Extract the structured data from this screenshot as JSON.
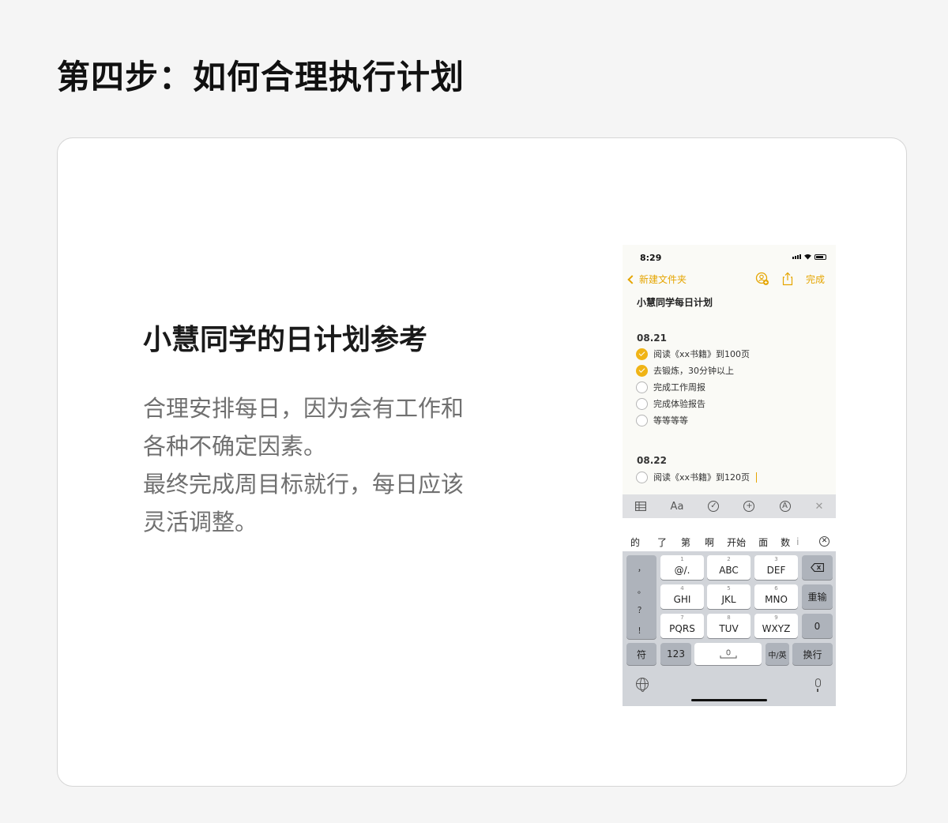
{
  "page": {
    "title": "第四步：如何合理执行计划"
  },
  "card": {
    "title": "小慧同学的日计划参考",
    "body_lines": [
      "合理安排每日，因为会有工作和",
      "各种不确定因素。",
      "最终完成周目标就行，每日应该",
      "灵活调整。"
    ]
  },
  "phone": {
    "status": {
      "time": "8:29"
    },
    "nav": {
      "back_label": "新建文件夹",
      "done_label": "完成"
    },
    "note": {
      "title": "小慧同学每日计划",
      "sections": [
        {
          "date": "08.21",
          "items": [
            {
              "text": "阅读《xx书籍》到100页",
              "done": true
            },
            {
              "text": "去锻炼，30分钟以上",
              "done": true
            },
            {
              "text": "完成工作周报",
              "done": false
            },
            {
              "text": "完成体验报告",
              "done": false
            },
            {
              "text": "等等等等",
              "done": false
            }
          ]
        },
        {
          "date": "08.22",
          "items": [
            {
              "text": "阅读《xx书籍》到120页",
              "done": false
            }
          ]
        }
      ]
    },
    "toolbar": {
      "format_label": "Aa"
    },
    "candidates": [
      "的",
      "了",
      "第",
      "啊",
      "开始",
      "面",
      "数",
      "i"
    ],
    "keyboard": {
      "punct": [
        "，",
        "。",
        "？",
        "！"
      ],
      "rows": [
        [
          {
            "num": "1",
            "label": "@/."
          },
          {
            "num": "2",
            "label": "ABC"
          },
          {
            "num": "3",
            "label": "DEF"
          }
        ],
        [
          {
            "num": "4",
            "label": "GHI"
          },
          {
            "num": "5",
            "label": "JKL"
          },
          {
            "num": "6",
            "label": "MNO"
          }
        ],
        [
          {
            "num": "7",
            "label": "PQRS"
          },
          {
            "num": "8",
            "label": "TUV"
          },
          {
            "num": "9",
            "label": "WXYZ"
          }
        ]
      ],
      "reenter_label": "重输",
      "zero_label": "0",
      "symbol_label": "符",
      "numbers_label": "123",
      "lang_label": "中/英",
      "return_label": "换行"
    }
  }
}
